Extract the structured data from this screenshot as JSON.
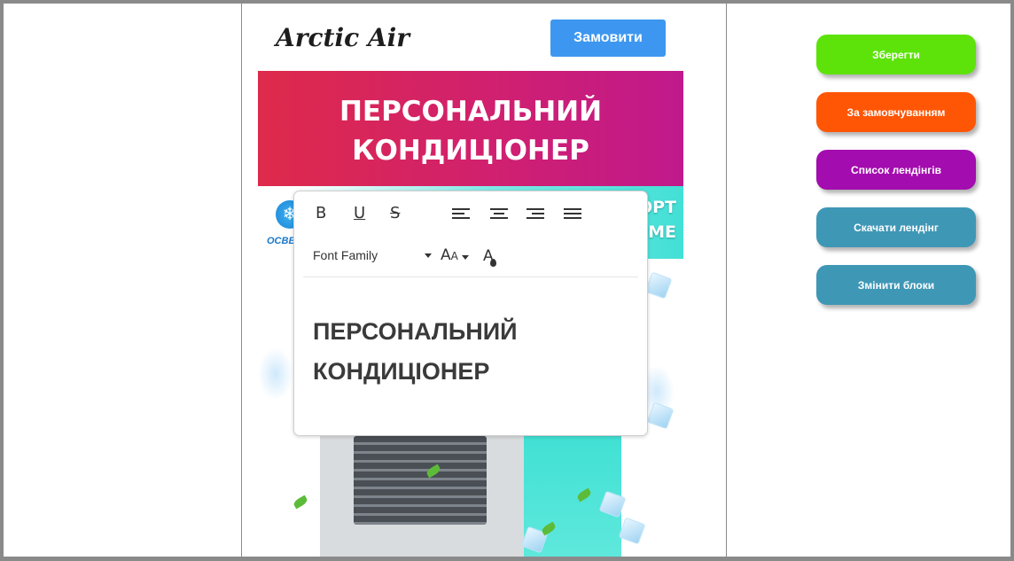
{
  "landing": {
    "logo": "Arctic Air",
    "order_button": "Замовити",
    "hero_line1": "ПЕРСОНАЛЬНИЙ",
    "hero_line2": "КОНДИЦІОНЕР",
    "strip_left": "ОСВЕ",
    "strip_right_line1": "ОРТ",
    "strip_right_line2": "РМЕ"
  },
  "editor": {
    "toolbar": {
      "bold": "B",
      "underline": "U",
      "strikethrough": "S",
      "font_family": "Font Family",
      "font_size_big": "A",
      "font_size_small": "A",
      "font_color": "A"
    },
    "content_line1": "ПЕРСОНАЛЬНИЙ",
    "content_line2": "КОНДИЦІОНЕР"
  },
  "side_panel": {
    "buttons": [
      {
        "label": "Зберегти",
        "color": "#5de30a"
      },
      {
        "label": "За замовчуванням",
        "color": "#ff5606"
      },
      {
        "label": "Список лендінгів",
        "color": "#a30cae"
      },
      {
        "label": "Скачати лендінг",
        "color": "#3f97b6"
      },
      {
        "label": "Змінити блоки",
        "color": "#3f97b6"
      }
    ]
  },
  "colors": {
    "order_button": "#3d97f0",
    "hero_gradient_start": "#de2a4a",
    "hero_gradient_end": "#c0198c"
  }
}
